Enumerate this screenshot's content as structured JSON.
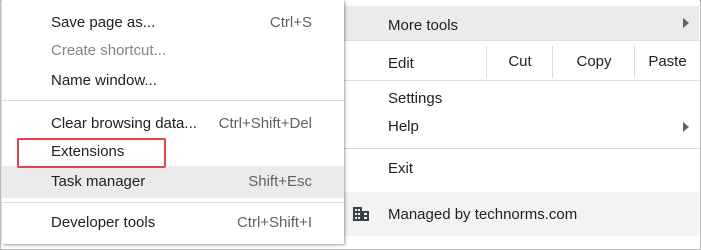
{
  "more_tools_submenu": {
    "items": [
      {
        "label": "Save page as...",
        "shortcut": "Ctrl+S"
      },
      {
        "label": "Create shortcut...",
        "shortcut": ""
      },
      {
        "label": "Name window...",
        "shortcut": ""
      },
      {
        "label": "Clear browsing data...",
        "shortcut": "Ctrl+Shift+Del"
      },
      {
        "label": "Extensions",
        "shortcut": ""
      },
      {
        "label": "Task manager",
        "shortcut": "Shift+Esc"
      },
      {
        "label": "Developer tools",
        "shortcut": "Ctrl+Shift+I"
      }
    ]
  },
  "main_menu": {
    "more_tools": "More tools",
    "edit": {
      "label": "Edit",
      "cut": "Cut",
      "copy": "Copy",
      "paste": "Paste"
    },
    "settings": "Settings",
    "help": "Help",
    "exit": "Exit",
    "managed": "Managed by technorms.com"
  },
  "colors": {
    "highlight_row": "#ebebeb",
    "annotation_box": "#e0474c",
    "managed_bg": "#f1f3f4"
  },
  "icons": {
    "submenu_arrow": "chevron-right-icon",
    "managed": "building-icon"
  }
}
